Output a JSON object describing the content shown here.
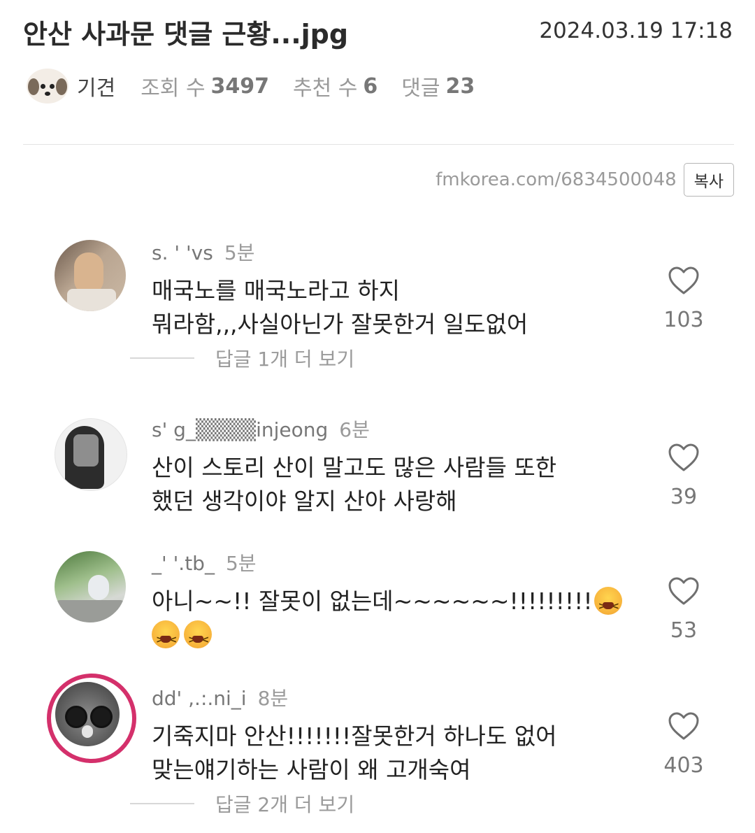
{
  "post": {
    "title": "안산 사과문 댓글 근황...jpg",
    "date": "2024.03.19 17:18",
    "author": "기견",
    "views_label": "조회 수",
    "views": "3497",
    "recommend_label": "추천 수",
    "recommend": "6",
    "comments_label": "댓글",
    "comments": "23",
    "url": "fmkorea.com/6834500048",
    "copy_label": "복사"
  },
  "comments": [
    {
      "user": "s.  ' 'vs",
      "time": "5분",
      "line1": "매국노를 매국노라고 하지",
      "line2": "뭐라함,,,사실아닌가 잘못한거 일도없어",
      "likes": "103",
      "replies": "답글 1개 더 보기"
    },
    {
      "user": "s'  g_▒▒▒▒injeong",
      "time": "6분",
      "line1": "산이 스토리 산이 말고도 많은 사람들 또한",
      "line2": "했던 생각이야 알지 산아 사랑해",
      "likes": "39"
    },
    {
      "user": "_' '.tb_",
      "time": "5분",
      "line1": "아니~~!! 잘못이 없는데~~~~~~!!!!!!!!!",
      "line2": "",
      "likes": "53"
    },
    {
      "user": "dd'  ,.:.ni_i",
      "time": "8분",
      "line1": "기죽지마 안산!!!!!!!잘못한거 하나도 없어",
      "line2": "맞는얘기하는 사람이 왜 고개숙여",
      "likes": "403",
      "replies": "답글 2개 더 보기"
    }
  ],
  "colors": {
    "story_ring": "#d4306b",
    "text": "#222222",
    "muted": "#9a9a9a"
  },
  "icons": [
    "heart-icon",
    "tired-face-emoji"
  ]
}
